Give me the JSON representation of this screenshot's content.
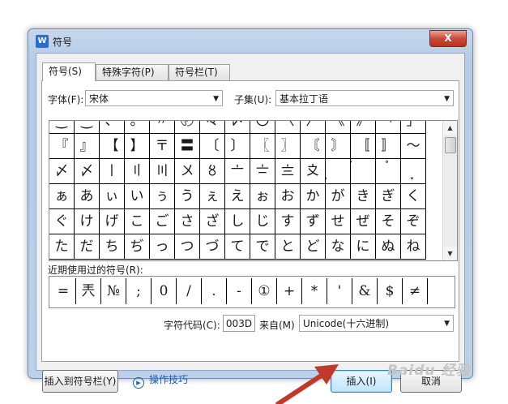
{
  "window": {
    "title": "符号",
    "close_label": "X",
    "app_icon": "W"
  },
  "tabs": [
    {
      "label": "符号(S)",
      "active": true
    },
    {
      "label": "特殊字符(P)",
      "active": false
    },
    {
      "label": "符号栏(T)",
      "active": false
    }
  ],
  "font": {
    "label": "字体(F):",
    "value": "宋体"
  },
  "subset": {
    "label": "子集(U):",
    "value": "基本拉丁语"
  },
  "symbol_rows": [
    [
      "⁐",
      "⁐",
      "、",
      "。",
      "〃",
      "〄",
      "々",
      "〆",
      "〇",
      "〈",
      "〉",
      "《",
      "》",
      "「",
      "」"
    ],
    [
      "『",
      "』",
      "【",
      "】",
      "〒",
      "〓",
      "〔",
      "〕",
      "〖",
      "〗",
      "〘",
      "〙",
      "〚",
      "〛",
      "〜"
    ],
    [
      "〆",
      "〆",
      "〡",
      "〢",
      "〣",
      "〤",
      "〥",
      "〦",
      "〧",
      "〨",
      "〩",
      "〪",
      "〫",
      "〬",
      "〭"
    ],
    [
      "ぁ",
      "あ",
      "ぃ",
      "い",
      "ぅ",
      "う",
      "ぇ",
      "え",
      "ぉ",
      "お",
      "か",
      "が",
      "き",
      "ぎ",
      "く"
    ],
    [
      "ぐ",
      "け",
      "げ",
      "こ",
      "ご",
      "さ",
      "ざ",
      "し",
      "じ",
      "す",
      "ず",
      "せ",
      "ぜ",
      "そ",
      "ぞ"
    ],
    [
      "た",
      "だ",
      "ち",
      "ぢ",
      "っ",
      "つ",
      "づ",
      "て",
      "で",
      "と",
      "ど",
      "な",
      "に",
      "ぬ",
      "ね"
    ]
  ],
  "recent": {
    "label": "近期使用过的符号(R):",
    "symbols": [
      "=",
      "兲",
      "№",
      ";",
      "0",
      "/",
      ".",
      "-",
      "①",
      "+",
      "*",
      "'",
      "&",
      "$",
      "≠"
    ]
  },
  "char_code": {
    "label": "字符代码(C):",
    "value": "003D"
  },
  "from": {
    "label": "来自(M)",
    "value": "Unicode(十六进制)"
  },
  "buttons": {
    "insert_to_bar": "插入到符号栏(Y)",
    "tips": "操作技巧",
    "insert": "插入(I)",
    "cancel": "取消"
  },
  "watermark": "Baidu 经验",
  "accent_colors": {
    "arrow": "#c0392b",
    "link": "#1f5fb0",
    "title_bar": "#c4d7ed"
  }
}
